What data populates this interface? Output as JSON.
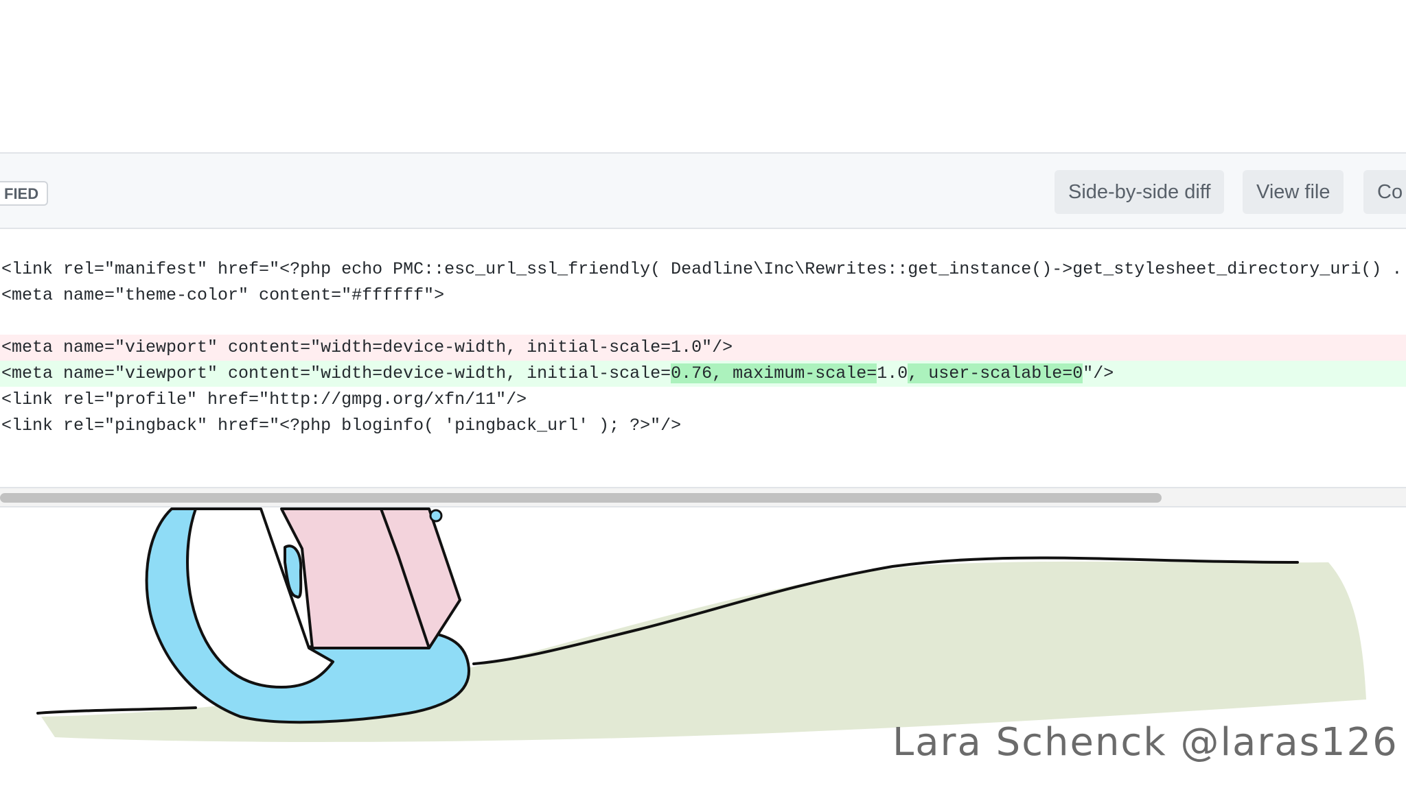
{
  "header": {
    "badge_label": "FIED",
    "side_by_side_label": "Side-by-side diff",
    "view_file_label": "View file",
    "comment_label": "Co"
  },
  "code": {
    "line1": "<link rel=\"manifest\" href=\"<?php echo PMC::esc_url_ssl_friendly( Deadline\\Inc\\Rewrites::get_instance()->get_stylesheet_directory_uri() .",
    "line2": "<meta name=\"theme-color\" content=\"#ffffff\">",
    "line3": "",
    "deleted_line": "<meta name=\"viewport\" content=\"width=device-width, initial-scale=1.0\"/>",
    "added_line": {
      "part1": "<meta name=\"viewport\" content=\"width=device-width, initial-scale=",
      "hl1": "0.76, maximum-scale=",
      "part2": "1.0",
      "hl2": ", user-scalable=0",
      "part3": "\"/>"
    },
    "line6": "<link rel=\"profile\" href=\"http://gmpg.org/xfn/11\"/>",
    "line7": "<link rel=\"pingback\" href=\"<?php bloginfo( 'pingback_url' ); ?>\"/>"
  },
  "colors": {
    "deleted_bg": "#ffeef0",
    "added_bg": "#e6ffed",
    "highlight": "#acf2bd",
    "character_blue": "#8fdcf6",
    "book_pink": "#f3d3dc",
    "hill_green": "#e2e9d4"
  },
  "signature": "Lara Schenck  @laras126"
}
